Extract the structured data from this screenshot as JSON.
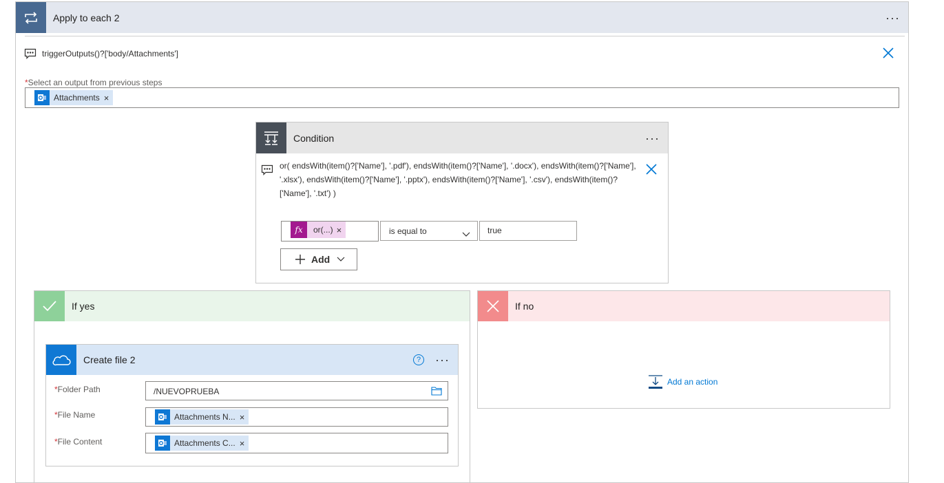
{
  "apply": {
    "title": "Apply to each 2",
    "expression": "triggerOutputs()?['body/Attachments']",
    "select_label": "Select an output from previous steps",
    "required_mark": "*",
    "token_label": "Attachments",
    "token_close": "×",
    "more": "···",
    "close": "✕",
    "header_color": "#4f6bed"
  },
  "condition": {
    "title": "Condition",
    "expression": "or( endsWith(item()?['Name'], '.pdf'), endsWith(item()?['Name'], '.docx'), endsWith(item()?['Name'], '.xlsx'), endsWith(item()?['Name'], '.pptx'), endsWith(item()?['Name'], '.csv'), endsWith(item()?['Name'], '.txt') )",
    "fx_symbol": "fx",
    "fx_token": "or(...)",
    "operator": "is equal to",
    "value": "true",
    "add_label": "Add",
    "more": "···",
    "close": "✕"
  },
  "if_yes": {
    "title": "If yes",
    "create_file": {
      "title": "Create file 2",
      "help": "?",
      "more": "···",
      "fields": [
        {
          "label": "Folder Path",
          "value": "/NUEVOPRUEBA"
        },
        {
          "label": "File Name",
          "token": "Attachments N..."
        },
        {
          "label": "File Content",
          "token": "Attachments C..."
        }
      ],
      "token_close": "×"
    }
  },
  "if_no": {
    "title": "If no",
    "add_action": "Add an action"
  },
  "icons": [
    "loop-icon",
    "comment-icon",
    "close-icon",
    "outlook-icon",
    "condition-icon",
    "fx-icon",
    "chevron-down-icon",
    "plus-icon",
    "check-icon",
    "x-icon",
    "onedrive-icon",
    "help-icon",
    "folder-icon",
    "add-action-icon"
  ]
}
